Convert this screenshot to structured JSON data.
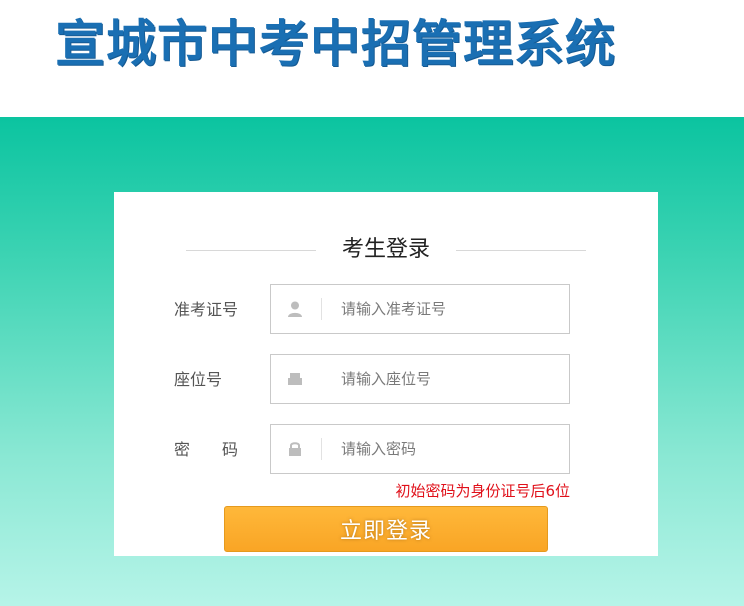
{
  "header": {
    "site_title": "宣城市中考中招管理系统"
  },
  "login": {
    "title": "考生登录",
    "fields": [
      {
        "label": "准考证号",
        "placeholder": "请输入准考证号",
        "icon": "user-icon"
      },
      {
        "label": "座位号",
        "placeholder": "请输入座位号",
        "icon": "seat-icon"
      },
      {
        "label": "密　　码",
        "placeholder": "请输入密码",
        "icon": "lock-icon"
      }
    ],
    "password_hint": "初始密码为身份证号后6位",
    "submit_label": "立即登录"
  },
  "colors": {
    "brand_blue": "#1a6fb3",
    "banner_top": "#0bc4a0",
    "banner_bottom": "#b6f4e8",
    "button": "#f9a525",
    "hint_red": "#e0101a"
  }
}
